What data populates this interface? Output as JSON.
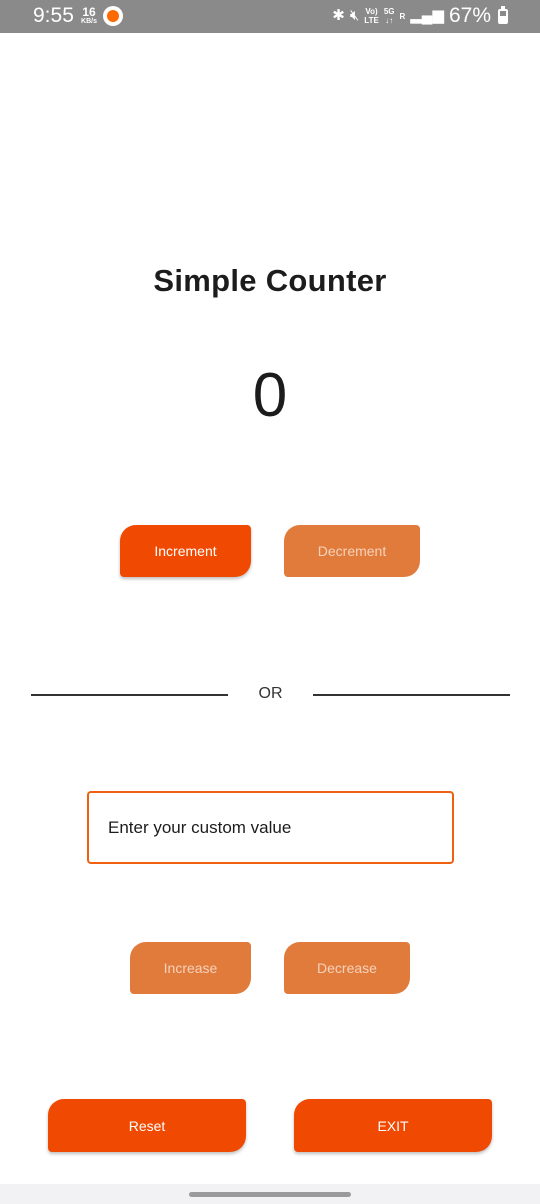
{
  "status_bar": {
    "time": "9:55",
    "net_speed": "16",
    "net_speed_unit": "KB/s",
    "volte_label": "Vo)",
    "lte_label": "LTE",
    "fiveg_label": "5G",
    "roaming_label": "R",
    "battery_percent": "67%",
    "icons": [
      "app-notification-icon",
      "bluetooth-icon",
      "mute-icon",
      "signal-icon",
      "battery-icon"
    ]
  },
  "app": {
    "title": "Simple Counter",
    "counter_value": "0"
  },
  "buttons": {
    "increment": "Increment",
    "decrement": "Decrement",
    "increase": "Increase",
    "decrease": "Decrease",
    "reset": "Reset",
    "exit": "EXIT"
  },
  "divider": {
    "label": "OR"
  },
  "custom_input": {
    "placeholder": "Enter your custom value",
    "value": ""
  },
  "colors": {
    "accent": "#f04a02",
    "accent_muted": "#e07b3c",
    "input_border": "#f0600e"
  }
}
